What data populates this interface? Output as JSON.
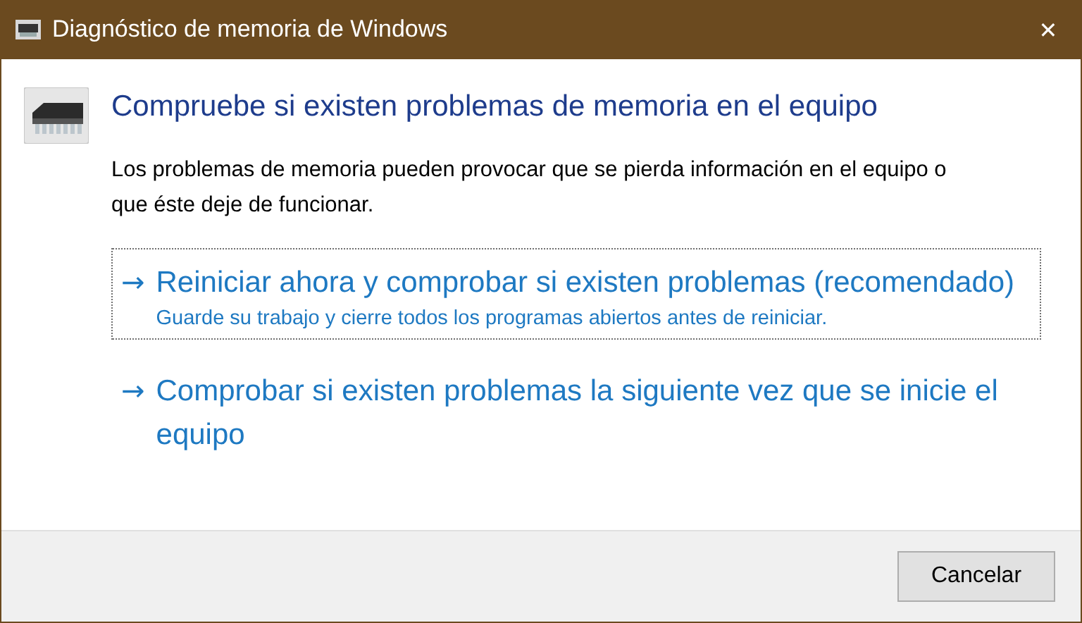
{
  "window": {
    "title": "Diagnóstico de memoria de Windows",
    "close": "✕"
  },
  "heading": "Compruebe si existen problemas de memoria en el equipo",
  "description": "Los problemas de memoria pueden provocar que se pierda información en el equipo o que éste deje de funcionar.",
  "options": [
    {
      "arrow": "→",
      "title": "Reiniciar ahora y comprobar si existen problemas (recomendado)",
      "note": "Guarde su trabajo y cierre todos los programas abiertos antes de reiniciar.",
      "focused": true
    },
    {
      "arrow": "→",
      "title": "Comprobar si existen problemas la siguiente vez que se inicie el equipo",
      "focused": false
    }
  ],
  "buttons": [
    "Cancelar"
  ]
}
